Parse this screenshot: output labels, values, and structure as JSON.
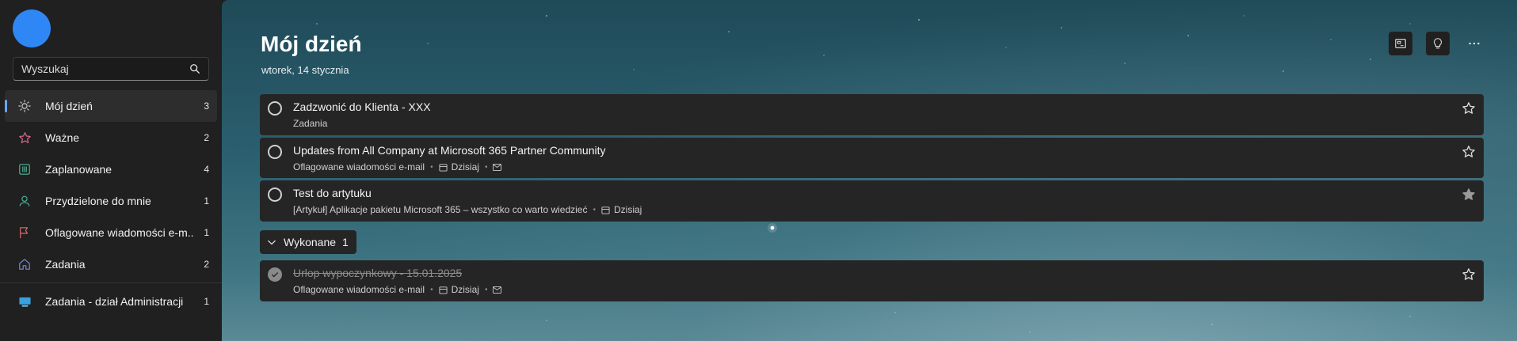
{
  "search": {
    "placeholder": "Wyszukaj"
  },
  "sidebar": {
    "items": [
      {
        "label": "Mój dzień",
        "count": "3",
        "icon": "sun-icon"
      },
      {
        "label": "Ważne",
        "count": "2",
        "icon": "star-icon"
      },
      {
        "label": "Zaplanowane",
        "count": "4",
        "icon": "calendar-icon"
      },
      {
        "label": "Przydzielone do mnie",
        "count": "1",
        "icon": "person-icon"
      },
      {
        "label": "Oflagowane wiadomości e-m...",
        "count": "1",
        "icon": "flag-icon"
      },
      {
        "label": "Zadania",
        "count": "2",
        "icon": "home-icon"
      },
      {
        "label": "Zadania - dział Administracji",
        "count": "1",
        "icon": "monitor-icon"
      }
    ]
  },
  "main": {
    "title": "Mój dzień",
    "subtitle": "wtorek, 14 stycznia",
    "tasks": [
      {
        "title": "Zadzwonić do Klienta - XXX",
        "list": "Zadania"
      },
      {
        "title": "Updates from All Company at Microsoft 365 Partner Community",
        "list": "Oflagowane wiadomości e-mail",
        "due": "Dzisiaj"
      },
      {
        "title": "Test do artytuku",
        "list": "[Artykuł] Aplikacje pakietu Microsoft 365 – wszystko co warto wiedzieć",
        "due": "Dzisiaj",
        "important": true
      }
    ],
    "completed": {
      "label": "Wykonane",
      "count": "1",
      "tasks": [
        {
          "title": "Urlop wypoczynkowy - 15.01.2025",
          "list": "Oflagowane wiadomości e-mail",
          "due": "Dzisiaj"
        }
      ]
    }
  },
  "colors": {
    "accent": "#6aa7f0",
    "avatar": "#2f87f5",
    "flag": "#e06a6a",
    "task_bg": "#252525"
  }
}
